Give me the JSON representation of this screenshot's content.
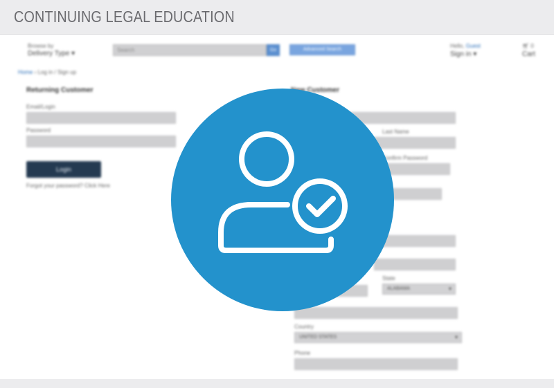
{
  "banner": {
    "title": "CONTINUING LEGAL EDUCATION"
  },
  "header": {
    "browse_by_label": "Browse by",
    "delivery_type_label": "Delivery Type ▾",
    "search_placeholder": "Search",
    "search_button_label": "Go",
    "blue_button_label": "Advanced Search",
    "hello_label": "Hello,",
    "guest_label": "Guest",
    "sign_in_label": "Sign in ▾",
    "cart_count": "0",
    "cart_label": "Cart"
  },
  "breadcrumb": {
    "home": "Home",
    "separator": "›",
    "current": "Log in / Sign up"
  },
  "returning": {
    "heading": "Returning Customer",
    "email_label": "Email/Login",
    "password_label": "Password",
    "login_button": "Login",
    "forgot_text": "Forgot your password? Click Here"
  },
  "new_customer": {
    "heading": "New Customer",
    "last_name_label": "Last Name",
    "confirm_password_label": "Confirm Password",
    "state_label": "State",
    "state_value": "ALABAMA",
    "country_label": "Country",
    "country_value": "UNITED STATES",
    "phone_label": "Phone"
  },
  "overlay": {
    "icon": "user-check-icon",
    "color": "#2392cc"
  },
  "colors": {
    "banner_bg": "#ececee",
    "banner_text": "#6b6b6f",
    "login_button": "#243a51",
    "link": "#2b6fb8"
  }
}
